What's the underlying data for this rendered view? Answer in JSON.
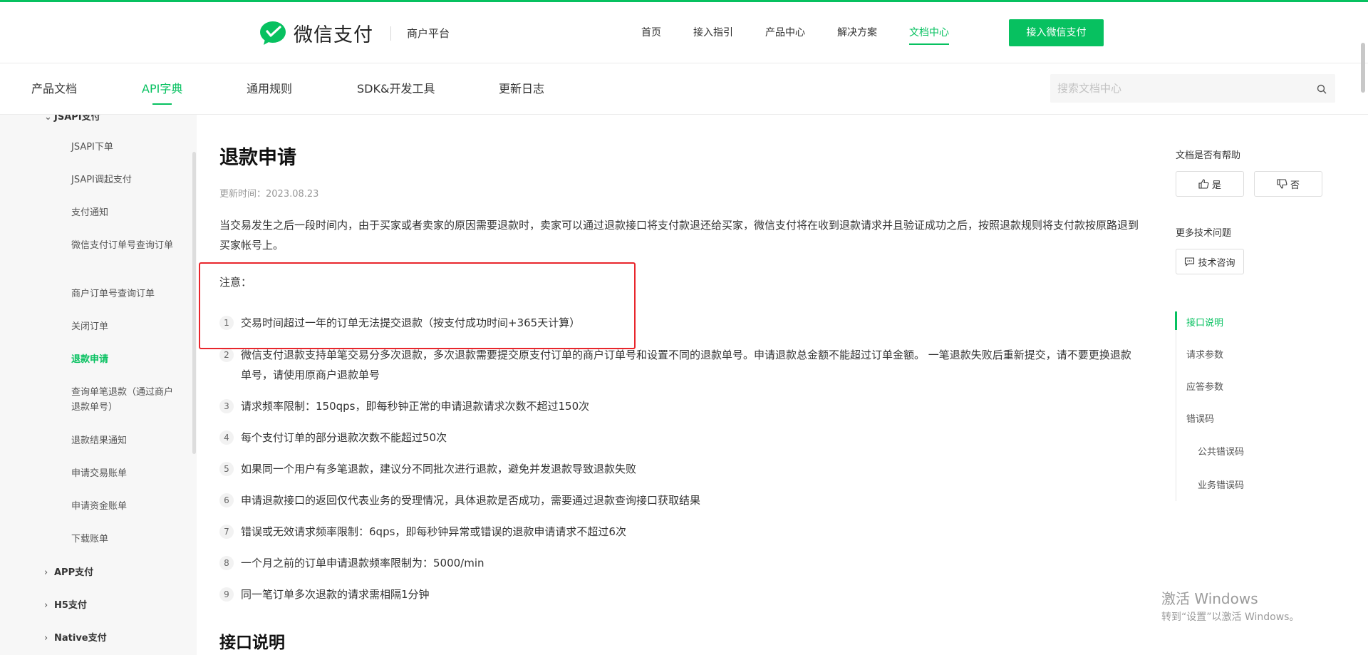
{
  "header": {
    "logo_text": "微信支付",
    "logo_sub": "商户平台",
    "nav": [
      "首页",
      "接入指引",
      "产品中心",
      "解决方案",
      "文档中心"
    ],
    "active_nav": "文档中心",
    "join_button": "接入微信支付"
  },
  "subnav": {
    "tabs": [
      "产品文档",
      "API字典",
      "通用规则",
      "SDK&开发工具",
      "更新日志"
    ],
    "active_tab": "API字典",
    "search_placeholder": "搜索文档中心"
  },
  "sidebar": {
    "top_category": "JSAPI支付",
    "items": [
      "JSAPI下单",
      "JSAPI调起支付",
      "支付通知",
      "微信支付订单号查询订单",
      "商户订单号查询订单",
      "关闭订单",
      "退款申请",
      "查询单笔退款（通过商户退款单号）",
      "退款结果通知",
      "申请交易账单",
      "申请资金账单",
      "下载账单"
    ],
    "active_item": "退款申请",
    "categories": [
      "APP支付",
      "H5支付",
      "Native支付"
    ]
  },
  "main": {
    "title": "退款申请",
    "updated": "更新时间：2023.08.23",
    "intro": "当交易发生之后一段时间内，由于买家或者卖家的原因需要退款时，卖家可以通过退款接口将支付款退还给买家，微信支付将在收到退款请求并且验证成功之后，按照退款规则将支付款按原路退到买家帐号上。",
    "note_title": "注意：",
    "notes": [
      {
        "num": "1",
        "text": "交易时间超过一年的订单无法提交退款（按支付成功时间+365天计算）"
      },
      {
        "num": "2",
        "text": "微信支付退款支持单笔交易分多次退款，多次退款需要提交原支付订单的商户订单号和设置不同的退款单号。申请退款总金额不能超过订单金额。 一笔退款失败后重新提交，请不要更换退款单号，请使用原商户退款单号"
      },
      {
        "num": "3",
        "text": "请求频率限制：150qps，即每秒钟正常的申请退款请求次数不超过150次"
      },
      {
        "num": "4",
        "text": "每个支付订单的部分退款次数不能超过50次"
      },
      {
        "num": "5",
        "text": "如果同一个用户有多笔退款，建议分不同批次进行退款，避免并发退款导致退款失败"
      },
      {
        "num": "6",
        "text": "申请退款接口的返回仅代表业务的受理情况，具体退款是否成功，需要通过退款查询接口获取结果"
      },
      {
        "num": "7",
        "text": "错误或无效请求频率限制：6qps，即每秒钟异常或错误的退款申请请求不超过6次"
      },
      {
        "num": "8",
        "text": "一个月之前的订单申请退款频率限制为：5000/min"
      },
      {
        "num": "9",
        "text": "同一笔订单多次退款的请求需相隔1分钟"
      }
    ],
    "section_heading": "接口说明"
  },
  "aside": {
    "helpful_label": "文档是否有帮助",
    "yes": "是",
    "no": "否",
    "more_label": "更多技术问题",
    "consult": "技术咨询",
    "toc": [
      "接口说明",
      "请求参数",
      "应答参数",
      "错误码",
      "公共错误码",
      "业务错误码"
    ],
    "toc_active": "接口说明"
  },
  "watermark": {
    "line1": "激活 Windows",
    "line2": "转到“设置”以激活 Windows。"
  },
  "colors": {
    "brand_green": "#07c160",
    "highlight_red": "#e8262c"
  }
}
